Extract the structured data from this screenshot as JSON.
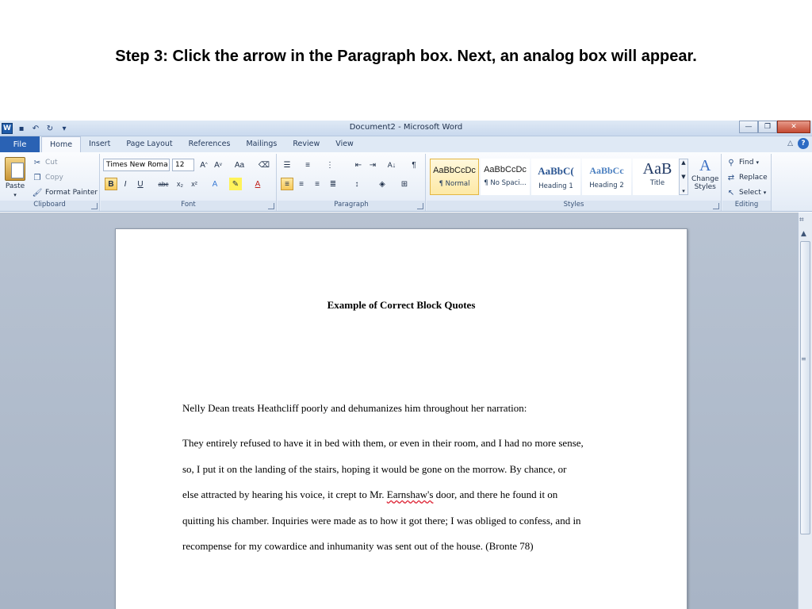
{
  "slide": {
    "title": "Step 3: Click the arrow in the Paragraph box. Next, an analog box will appear."
  },
  "window": {
    "title": "Document2 - Microsoft Word",
    "app_logo": "W"
  },
  "tabs": {
    "file": "File",
    "items": [
      "Home",
      "Insert",
      "Page Layout",
      "References",
      "Mailings",
      "Review",
      "View"
    ],
    "active": "Home"
  },
  "ribbon": {
    "clipboard": {
      "label": "Clipboard",
      "paste": "Paste",
      "cut": "Cut",
      "copy": "Copy",
      "format_painter": "Format Painter"
    },
    "font": {
      "label": "Font",
      "font_name": "Times New Roma",
      "font_size": "12",
      "change_case": "Aa"
    },
    "paragraph": {
      "label": "Paragraph"
    },
    "styles": {
      "label": "Styles",
      "items": [
        {
          "sample": "AaBbCcDc",
          "name": "¶ Normal"
        },
        {
          "sample": "AaBbCcDc",
          "name": "¶ No Spaci..."
        },
        {
          "sample": "AaBbC(",
          "name": "Heading 1"
        },
        {
          "sample": "AaBbCc",
          "name": "Heading 2"
        },
        {
          "sample": "AaB",
          "name": "Title"
        }
      ],
      "change_styles_line1": "Change",
      "change_styles_line2": "Styles"
    },
    "editing": {
      "label": "Editing",
      "find": "Find",
      "replace": "Replace",
      "select": "Select"
    }
  },
  "colors": {
    "callout": "#ef7d2d",
    "file_tab": "#2a62b4"
  },
  "document": {
    "heading": "Example of Correct Block Quotes",
    "intro": "Nelly Dean treats Heathcliff poorly and dehumanizes him throughout her narration:",
    "quote_lines": [
      "They entirely refused to have it in bed with them, or even in their room, and I had no more sense,",
      "so, I put it on the landing of the stairs, hoping it would be gone on the morrow. By chance, or",
      "else attracted by hearing his voice, it crept to Mr.",
      "quitting his chamber. Inquiries were made as to how it got there; I was obliged to confess, and in",
      "recompense for my cowardice and inhumanity was sent out of the house. (Bronte 78)"
    ],
    "misspelled": "Earnshaw's",
    "line3_tail": "door, and there he found it on"
  }
}
